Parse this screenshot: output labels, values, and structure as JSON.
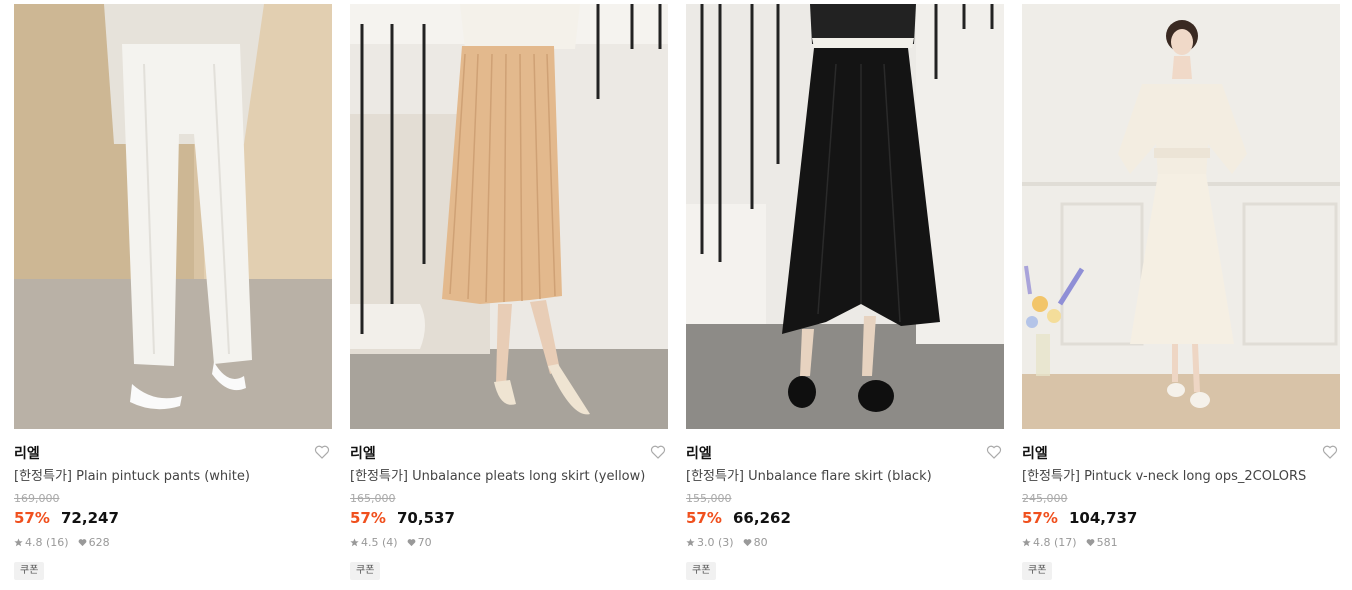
{
  "products": [
    {
      "brand": "리엘",
      "title": "[한정특가] Plain pintuck pants (white)",
      "original_price": "169,000",
      "discount": "57%",
      "price": "72,247",
      "rating": "4.8",
      "reviews": "(16)",
      "likes": "628",
      "badge": "쿠폰"
    },
    {
      "brand": "리엘",
      "title": "[한정특가] Unbalance pleats long skirt (yellow)",
      "original_price": "165,000",
      "discount": "57%",
      "price": "70,537",
      "rating": "4.5",
      "reviews": "(4)",
      "likes": "70",
      "badge": "쿠폰"
    },
    {
      "brand": "리엘",
      "title": "[한정특가] Unbalance flare skirt (black)",
      "original_price": "155,000",
      "discount": "57%",
      "price": "66,262",
      "rating": "3.0",
      "reviews": "(3)",
      "likes": "80",
      "badge": "쿠폰"
    },
    {
      "brand": "리엘",
      "title": "[한정특가] Pintuck v-neck long ops_2COLORS",
      "original_price": "245,000",
      "discount": "57%",
      "price": "104,737",
      "rating": "4.8",
      "reviews": "(17)",
      "likes": "581",
      "badge": "쿠폰"
    }
  ],
  "colors": {
    "discount": "#f0501e",
    "badge_bg": "#f1f1f1",
    "muted": "#999999"
  },
  "icons": {
    "like": "heart-outline-icon",
    "rating": "star-icon",
    "likes": "heart-filled-icon"
  }
}
